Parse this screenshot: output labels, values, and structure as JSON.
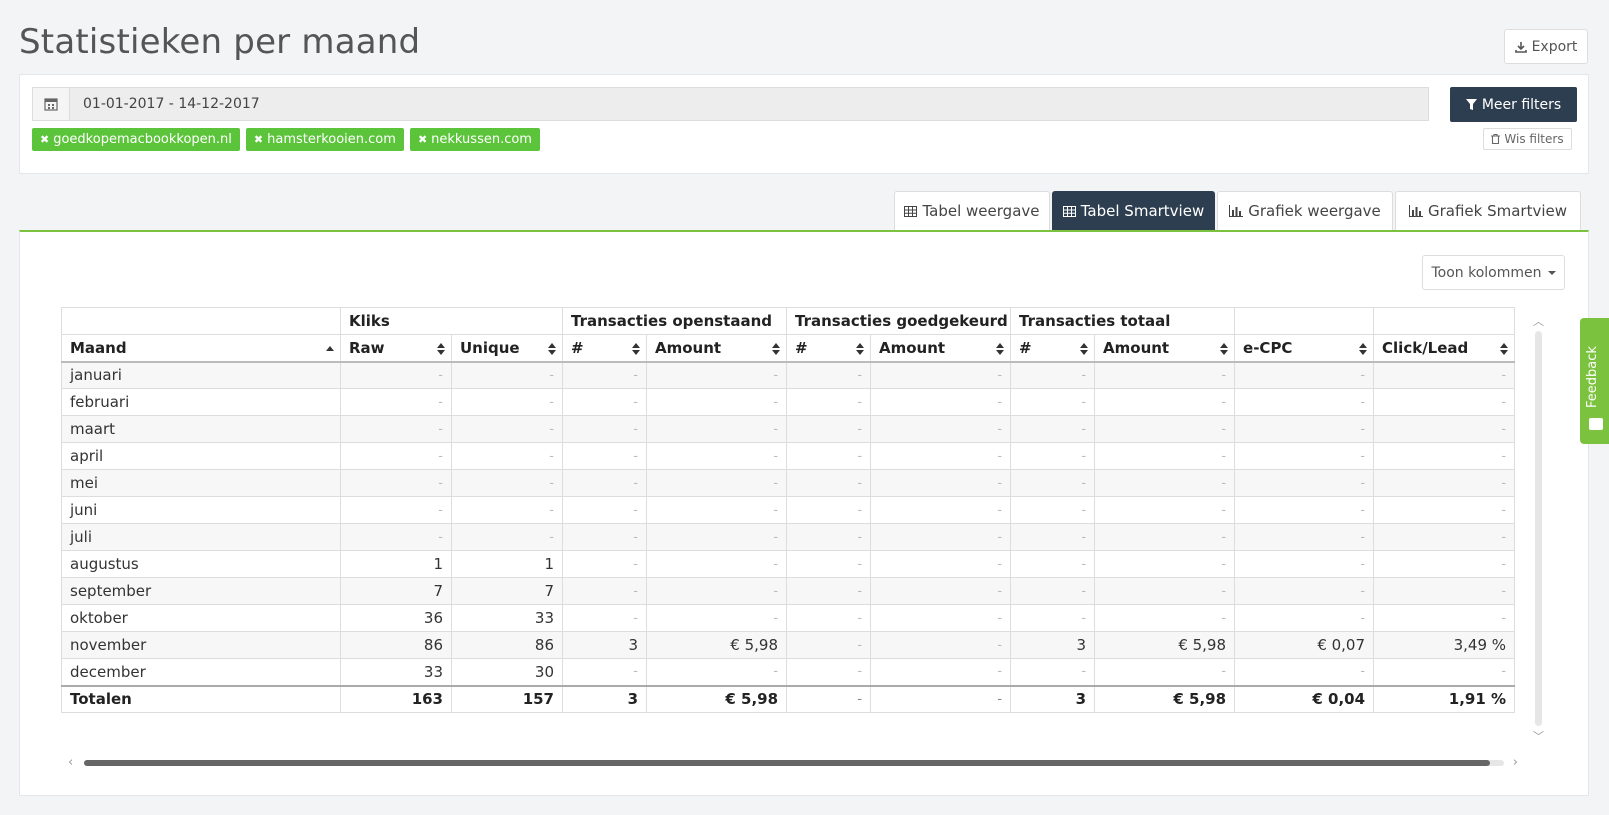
{
  "page": {
    "title": "Statistieken per maand"
  },
  "header": {
    "export_label": "Export"
  },
  "filters": {
    "date_range": "01-01-2017 - 14-12-2017",
    "more_filters_label": "Meer filters",
    "clear_filters_label": "Wis filters",
    "tags": [
      "goedkopemacbookkopen.nl",
      "hamsterkooien.com",
      "nekkussen.com"
    ]
  },
  "tabs": [
    {
      "label": "Tabel weergave",
      "icon": "table-icon",
      "active": false
    },
    {
      "label": "Tabel Smartview",
      "icon": "table-icon",
      "active": true
    },
    {
      "label": "Grafiek weergave",
      "icon": "bar-chart-icon",
      "active": false
    },
    {
      "label": "Grafiek Smartview",
      "icon": "bar-chart-icon",
      "active": false
    }
  ],
  "columns_button": {
    "label": "Toon kolommen"
  },
  "table": {
    "groups": [
      "",
      "Kliks",
      "Transacties openstaand",
      "Transacties goedgekeurd",
      "Transacties totaal",
      "",
      ""
    ],
    "columns": [
      "Maand",
      "Raw",
      "Unique",
      "#",
      "Amount",
      "#",
      "Amount",
      "#",
      "Amount",
      "e-CPC",
      "Click/Lead"
    ],
    "rows": [
      [
        "januari",
        "-",
        "-",
        "-",
        "-",
        "-",
        "-",
        "-",
        "-",
        "-",
        "-"
      ],
      [
        "februari",
        "-",
        "-",
        "-",
        "-",
        "-",
        "-",
        "-",
        "-",
        "-",
        "-"
      ],
      [
        "maart",
        "-",
        "-",
        "-",
        "-",
        "-",
        "-",
        "-",
        "-",
        "-",
        "-"
      ],
      [
        "april",
        "-",
        "-",
        "-",
        "-",
        "-",
        "-",
        "-",
        "-",
        "-",
        "-"
      ],
      [
        "mei",
        "-",
        "-",
        "-",
        "-",
        "-",
        "-",
        "-",
        "-",
        "-",
        "-"
      ],
      [
        "juni",
        "-",
        "-",
        "-",
        "-",
        "-",
        "-",
        "-",
        "-",
        "-",
        "-"
      ],
      [
        "juli",
        "-",
        "-",
        "-",
        "-",
        "-",
        "-",
        "-",
        "-",
        "-",
        "-"
      ],
      [
        "augustus",
        "1",
        "1",
        "-",
        "-",
        "-",
        "-",
        "-",
        "-",
        "-",
        "-"
      ],
      [
        "september",
        "7",
        "7",
        "-",
        "-",
        "-",
        "-",
        "-",
        "-",
        "-",
        "-"
      ],
      [
        "oktober",
        "36",
        "33",
        "-",
        "-",
        "-",
        "-",
        "-",
        "-",
        "-",
        "-"
      ],
      [
        "november",
        "86",
        "86",
        "3",
        "€ 5,98",
        "-",
        "-",
        "3",
        "€ 5,98",
        "€ 0,07",
        "3,49 %"
      ],
      [
        "december",
        "33",
        "30",
        "-",
        "-",
        "-",
        "-",
        "-",
        "-",
        "-",
        "-"
      ]
    ],
    "totals": [
      "Totalen",
      "163",
      "157",
      "3",
      "€ 5,98",
      "-",
      "-",
      "3",
      "€ 5,98",
      "€ 0,04",
      "1,91 %"
    ]
  },
  "feedback": {
    "label": "Feedback"
  }
}
